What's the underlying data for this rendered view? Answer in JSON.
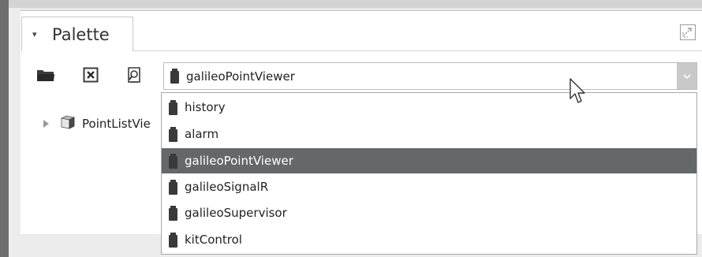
{
  "palette": {
    "title": "Palette",
    "selected_module": "galileoPointViewer",
    "tree_item": "PointListVie",
    "options": [
      {
        "label": "history",
        "selected": false
      },
      {
        "label": "alarm",
        "selected": false
      },
      {
        "label": "galileoPointViewer",
        "selected": true
      },
      {
        "label": "galileoSignalR",
        "selected": false
      },
      {
        "label": "galileoSupervisor",
        "selected": false
      },
      {
        "label": "kitControl",
        "selected": false
      }
    ]
  },
  "toolbar": {
    "icons": [
      "folder-icon",
      "close-box-icon",
      "search-page-icon"
    ]
  },
  "colors": {
    "selected_row": "#666769",
    "module_jar": "#3a3a3a",
    "left_rail": "#6e6e6e"
  }
}
